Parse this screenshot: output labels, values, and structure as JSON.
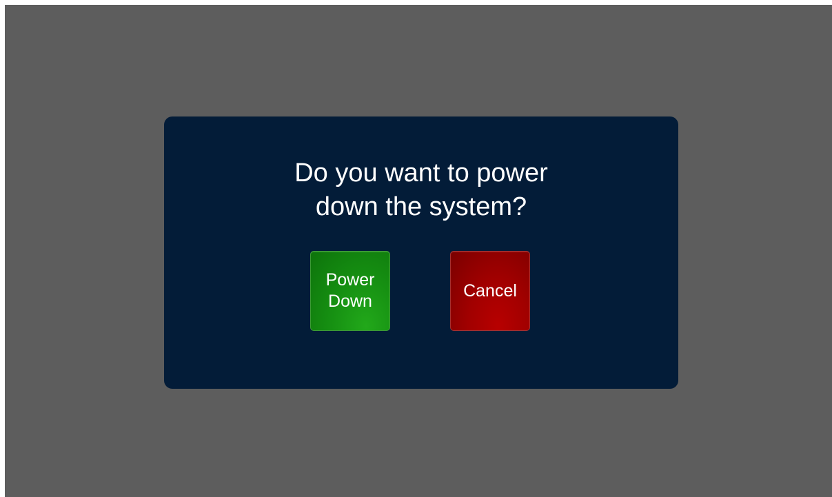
{
  "dialog": {
    "message_line1": "Do you want to power",
    "message_line2": "down the system?"
  },
  "buttons": {
    "power_down_line1": "Power",
    "power_down_line2": "Down",
    "cancel": "Cancel"
  },
  "colors": {
    "background": "#5d5d5d",
    "dialog": "#031c38",
    "confirm": "#169012",
    "cancel": "#a10000",
    "text": "#ffffff"
  }
}
